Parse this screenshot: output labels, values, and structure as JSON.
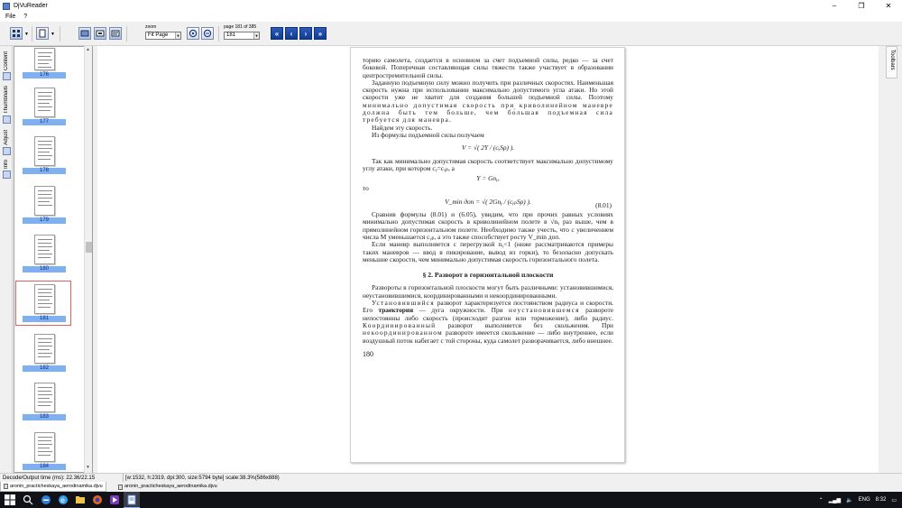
{
  "window": {
    "title": "DjVuReader",
    "controls": [
      "–",
      "❐",
      "✕"
    ]
  },
  "menu": [
    "File",
    "?"
  ],
  "toolbar": {
    "zoom_label": "zoom",
    "zoom_value": "Fit Page",
    "page_label": "page 181 of 385",
    "page_value": "181",
    "nav_first": "«",
    "nav_prev": "‹",
    "nav_next": "›",
    "nav_last": "»"
  },
  "left_dock_tabs": [
    "Content",
    "Thumbnails",
    "Adjust",
    "Info"
  ],
  "thumbnails": [
    {
      "page": "176",
      "selected": false
    },
    {
      "page": "177",
      "selected": false
    },
    {
      "page": "178",
      "selected": false
    },
    {
      "page": "179",
      "selected": false
    },
    {
      "page": "180",
      "selected": false
    },
    {
      "page": "181",
      "selected": true
    },
    {
      "page": "182",
      "selected": false
    },
    {
      "page": "183",
      "selected": false
    },
    {
      "page": "184",
      "selected": false
    }
  ],
  "right_dock": {
    "label": "Toolbars"
  },
  "page": {
    "p1": "торию самолета, создается в основном за счет подъемной силы, редко — за счет боковой. Поперечная составляющая силы тяжести также участвует в образовании центростремительной силы.",
    "p2a": "Заданную подъемную силу можно получить при различных скоростях. Наименьшая скорость нужна при использовании максимально допустимого угла атаки. Но этой скорости уже не хватит для создания большей подъемной силы. Поэтому ",
    "p2b": "минимально допустимая скорость при криволинейном маневре должна быть тем больше, чем бо́льшая подъемная сила требуется для маневра.",
    "p3": "Найдем эту скорость.",
    "p4": "Из формулы подъемной силы получаем",
    "f1": "V = √( 2Y / (cᵧSρ) ).",
    "p5": "Так как минимально допустимая скорость соответствует максимально допустимому углу атаки, при котором cᵧ=cᵧₚ, а",
    "f2": "Y = Gnᵧ,",
    "p6": "то",
    "f3": "V_min доп = √( 2Gnᵧ / (cᵧₚSρ) ).",
    "f3_num": "(8.01)",
    "p7": "Сравнив формулы (8.01) и (6.05), увидим, что при прочих равных условиях минимально допустимая скорость в криволинейном полете в √nᵧ раз выше, чем в прямолинейном горизонтальном полете. Необходимо также учесть, что с увеличением числа M уменьшается cᵧₚ, а это также способствует росту V_min доп.",
    "p8": "Если маневр выполняется с перегрузкой nᵧ<1 (ниже рассматриваются примеры таких маневров — ввод в пикирование, вывод из горки), то безопасно допускать меньшие скорости, чем минимально допустимая скорость горизонтального полета.",
    "section": "§ 2. Разворот в горизонтальной плоскости",
    "p9": "Развороты в горизонтальной плоскости могут быть различными: установившимися, неустановившимися, координированными и некоординированными.",
    "p10a": "Установившийся",
    "p10b": " разворот характеризуется постоянством радиуса и скорости. Его ",
    "p10c": "траектория",
    "p10d": " — дуга окружности. При ",
    "p10e": "неустановившемся",
    "p10f": " развороте непостоянны либо скорость (происходит разгон или торможение), либо радиус. ",
    "p10g": "Координированный",
    "p10h": " разворот выполняется без скольжения. При ",
    "p10i": "некоординированном",
    "p10j": " развороте имеется скольжение — либо внутреннее, если воздушный поток набегает с той стороны, куда самолет разворачивается, либо внешнее.",
    "page_number": "180"
  },
  "status": {
    "left": "Decode/Output time (ms): 22.36/22.15",
    "right": "[w:1532, h:2319, dpi:300, size:5794 byte] scale:38.3%(586x888)"
  },
  "doc_tabs": [
    "aronin_practicheskaya_aerodinamika.djvu",
    "aronin_practicheskaya_aerodinamika.djvu"
  ],
  "tray": {
    "lang": "ENG",
    "time": "8:32"
  }
}
